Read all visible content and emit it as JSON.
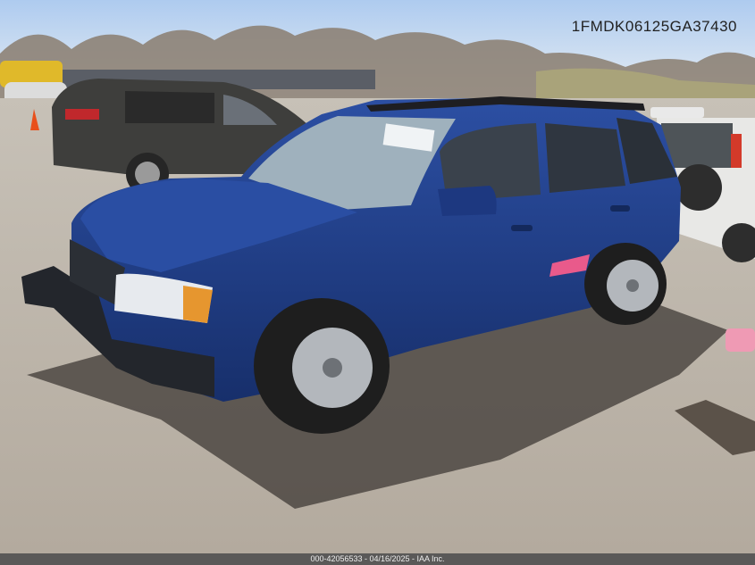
{
  "photo": {
    "vin_watermark": "1FMDK06125GA37430",
    "footer_caption": "000-42056533 - 04/16/2025 - IAA Inc.",
    "colors": {
      "sky": "#bcd3ee",
      "ground": "#b9b2a7",
      "car_body": "#1f3d86",
      "car_body_shadow": "#142a5e",
      "dark_suv": "#3e3e3c",
      "white_suv": "#e8e8e6"
    }
  }
}
